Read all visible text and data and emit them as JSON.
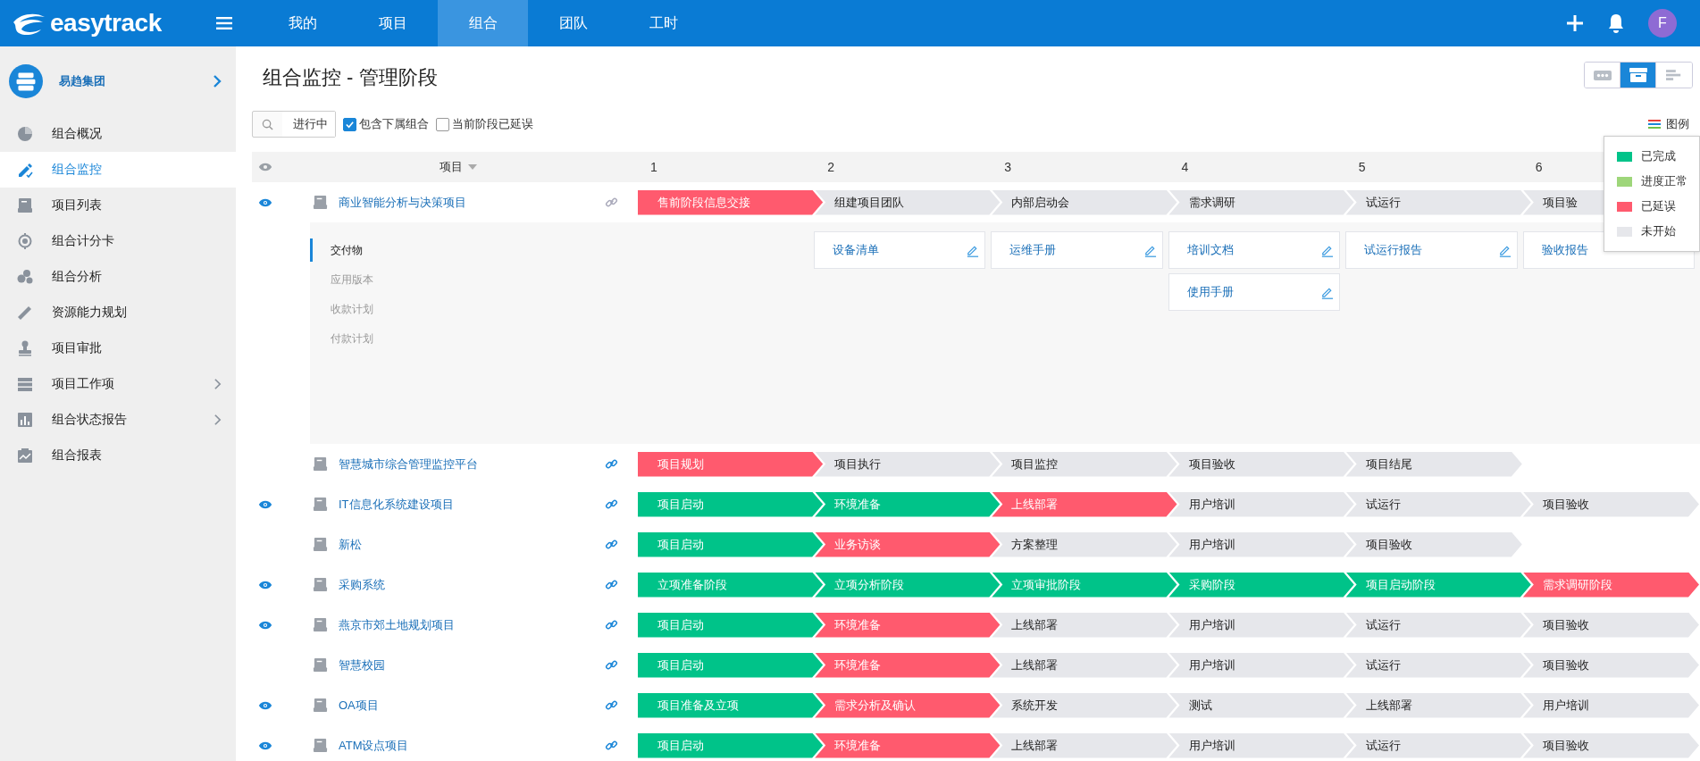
{
  "topbar": {
    "logo": "easytrack",
    "nav": [
      {
        "label": "我的",
        "selected": false
      },
      {
        "label": "项目",
        "selected": false
      },
      {
        "label": "组合",
        "selected": true
      },
      {
        "label": "团队",
        "selected": false
      },
      {
        "label": "工时",
        "selected": false
      }
    ],
    "avatar": "F"
  },
  "sidebar": {
    "org": "易趋集团",
    "items": [
      {
        "label": "组合概况",
        "kind": "pie",
        "selected": false,
        "has_submenu": false
      },
      {
        "label": "组合监控",
        "kind": "pen",
        "selected": true,
        "has_submenu": false
      },
      {
        "label": "项目列表",
        "kind": "tray",
        "selected": false,
        "has_submenu": false
      },
      {
        "label": "组合计分卡",
        "kind": "target",
        "selected": false,
        "has_submenu": false
      },
      {
        "label": "组合分析",
        "kind": "bubbles",
        "selected": false,
        "has_submenu": false
      },
      {
        "label": "资源能力规划",
        "kind": "ruler",
        "selected": false,
        "has_submenu": false
      },
      {
        "label": "项目审批",
        "kind": "stamp",
        "selected": false,
        "has_submenu": false
      },
      {
        "label": "项目工作项",
        "kind": "list",
        "selected": false,
        "has_submenu": true
      },
      {
        "label": "组合状态报告",
        "kind": "chart",
        "selected": false,
        "has_submenu": true
      },
      {
        "label": "组合报表",
        "kind": "report",
        "selected": false,
        "has_submenu": false
      }
    ]
  },
  "page": {
    "title": "组合监控 - 管理阶段",
    "view_buttons": [
      {
        "kind": "dots",
        "selected": false
      },
      {
        "kind": "card",
        "selected": true
      },
      {
        "kind": "gantt",
        "selected": false
      }
    ],
    "filter": {
      "value": "进行中"
    },
    "checkboxes": [
      {
        "label": "包含下属组合",
        "checked": true
      },
      {
        "label": "当前阶段已延误",
        "checked": false
      }
    ],
    "legend_toggle": "图例",
    "legend": [
      {
        "label": "已完成",
        "color": "#00c389"
      },
      {
        "label": "进度正常",
        "color": "#9ed67a"
      },
      {
        "label": "已延误",
        "color": "#ff5a6e"
      },
      {
        "label": "未开始",
        "color": "#e6e7eb"
      }
    ]
  },
  "table": {
    "project_column": "项目",
    "stage_columns": [
      "1",
      "2",
      "3",
      "4",
      "5",
      "6"
    ],
    "rows": [
      {
        "name": "商业智能分析与决策项目",
        "watched": true,
        "expanded": true,
        "detail_tabs": [
          {
            "label": "交付物",
            "selected": true
          },
          {
            "label": "应用版本",
            "selected": false
          },
          {
            "label": "收款计划",
            "selected": false
          },
          {
            "label": "付款计划",
            "selected": false
          }
        ],
        "stages": [
          {
            "label": "售前阶段信息交接",
            "kind": "delayed"
          },
          {
            "label": "组建项目团队",
            "kind": "pending",
            "deliverables": [
              "设备清单"
            ]
          },
          {
            "label": "内部启动会",
            "kind": "pending",
            "deliverables": [
              "运维手册"
            ]
          },
          {
            "label": "需求调研",
            "kind": "pending",
            "deliverables": [
              "培训文档",
              "使用手册"
            ]
          },
          {
            "label": "试运行",
            "kind": "pending",
            "deliverables": [
              "试运行报告"
            ]
          },
          {
            "label": "项目验",
            "kind": "pending",
            "deliverables": [
              "验收报告"
            ]
          }
        ]
      },
      {
        "name": "智慧城市综合管理监控平台",
        "watched": false,
        "expanded": false,
        "stages": [
          {
            "label": "项目规划",
            "kind": "delayed"
          },
          {
            "label": "项目执行",
            "kind": "pending"
          },
          {
            "label": "项目监控",
            "kind": "pending"
          },
          {
            "label": "项目验收",
            "kind": "pending"
          },
          {
            "label": "项目结尾",
            "kind": "pending"
          }
        ]
      },
      {
        "name": "IT信息化系统建设项目",
        "watched": true,
        "expanded": false,
        "stages": [
          {
            "label": "项目启动",
            "kind": "done"
          },
          {
            "label": "环境准备",
            "kind": "done"
          },
          {
            "label": "上线部署",
            "kind": "delayed"
          },
          {
            "label": "用户培训",
            "kind": "pending"
          },
          {
            "label": "试运行",
            "kind": "pending"
          },
          {
            "label": "项目验收",
            "kind": "pending"
          }
        ]
      },
      {
        "name": "新松",
        "watched": false,
        "expanded": false,
        "stages": [
          {
            "label": "项目启动",
            "kind": "done"
          },
          {
            "label": "业务访谈",
            "kind": "delayed"
          },
          {
            "label": "方案整理",
            "kind": "pending"
          },
          {
            "label": "用户培训",
            "kind": "pending"
          },
          {
            "label": "项目验收",
            "kind": "pending"
          }
        ]
      },
      {
        "name": "采购系统",
        "watched": true,
        "expanded": false,
        "stages": [
          {
            "label": "立项准备阶段",
            "kind": "done"
          },
          {
            "label": "立项分析阶段",
            "kind": "done"
          },
          {
            "label": "立项审批阶段",
            "kind": "done"
          },
          {
            "label": "采购阶段",
            "kind": "done"
          },
          {
            "label": "项目启动阶段",
            "kind": "done"
          },
          {
            "label": "需求调研阶段",
            "kind": "delayed"
          }
        ]
      },
      {
        "name": "燕京市郊土地规划项目",
        "watched": true,
        "expanded": false,
        "stages": [
          {
            "label": "项目启动",
            "kind": "done"
          },
          {
            "label": "环境准备",
            "kind": "delayed"
          },
          {
            "label": "上线部署",
            "kind": "pending"
          },
          {
            "label": "用户培训",
            "kind": "pending"
          },
          {
            "label": "试运行",
            "kind": "pending"
          },
          {
            "label": "项目验收",
            "kind": "pending"
          }
        ]
      },
      {
        "name": "智慧校园",
        "watched": false,
        "expanded": false,
        "stages": [
          {
            "label": "项目启动",
            "kind": "done"
          },
          {
            "label": "环境准备",
            "kind": "delayed"
          },
          {
            "label": "上线部署",
            "kind": "pending"
          },
          {
            "label": "用户培训",
            "kind": "pending"
          },
          {
            "label": "试运行",
            "kind": "pending"
          },
          {
            "label": "项目验收",
            "kind": "pending"
          }
        ]
      },
      {
        "name": "OA项目",
        "watched": true,
        "expanded": false,
        "stages": [
          {
            "label": "项目准备及立项",
            "kind": "done"
          },
          {
            "label": "需求分析及确认",
            "kind": "delayed"
          },
          {
            "label": "系统开发",
            "kind": "pending"
          },
          {
            "label": "测试",
            "kind": "pending"
          },
          {
            "label": "上线部署",
            "kind": "pending"
          },
          {
            "label": "用户培训",
            "kind": "pending"
          }
        ]
      },
      {
        "name": "ATM设点项目",
        "watched": true,
        "expanded": false,
        "stages": [
          {
            "label": "项目启动",
            "kind": "done"
          },
          {
            "label": "环境准备",
            "kind": "delayed"
          },
          {
            "label": "上线部署",
            "kind": "pending"
          },
          {
            "label": "用户培训",
            "kind": "pending"
          },
          {
            "label": "试运行",
            "kind": "pending"
          },
          {
            "label": "项目验收",
            "kind": "pending"
          }
        ]
      }
    ]
  }
}
